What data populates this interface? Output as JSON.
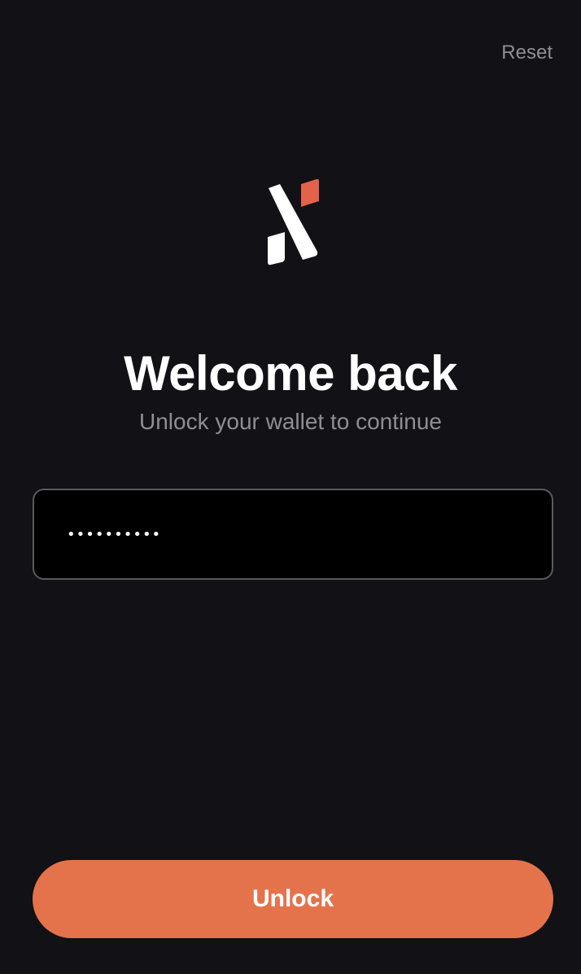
{
  "header": {
    "reset_label": "Reset"
  },
  "logo": {
    "icon": "wallet-logo-icon",
    "primary_color": "#ffffff",
    "accent_color": "#e4624c"
  },
  "welcome": {
    "title": "Welcome back",
    "subtitle": "Unlock your wallet to continue"
  },
  "password": {
    "value": "••••••••••",
    "placeholder": ""
  },
  "actions": {
    "unlock_label": "Unlock",
    "unlock_color": "#e4734c"
  }
}
